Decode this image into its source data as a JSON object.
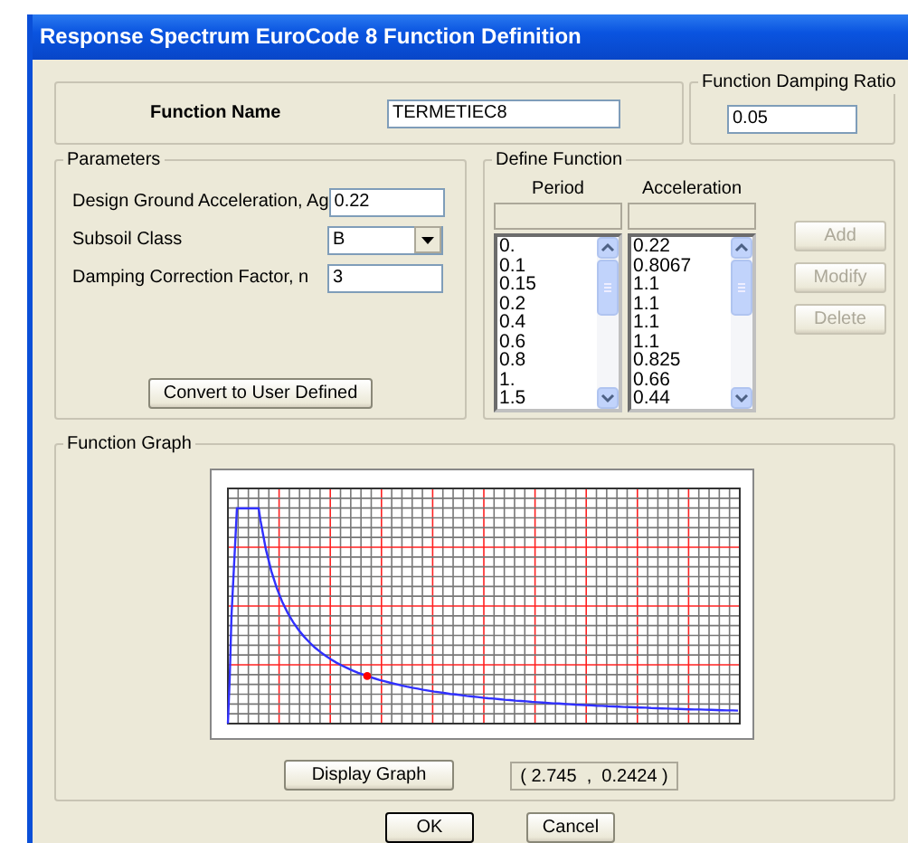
{
  "window": {
    "title": "Response Spectrum EuroCode 8 Function Definition"
  },
  "function_name": {
    "label": "Function Name",
    "value": "TERMETIEC8"
  },
  "damping_ratio": {
    "label": "Function Damping Ratio",
    "value": "0.05"
  },
  "parameters": {
    "label": "Parameters",
    "fields": [
      {
        "kind": "text",
        "label": "Design Ground Acceleration, Ag",
        "value": "0.22"
      },
      {
        "kind": "dropdown",
        "label": "Subsoil Class",
        "value": "B"
      },
      {
        "kind": "text",
        "label": "Damping Correction Factor, n",
        "value": "3"
      }
    ],
    "button": "Convert to User Defined"
  },
  "define_function": {
    "label": "Define Function",
    "columns": [
      {
        "heading": "Period",
        "items": [
          "0.",
          "0.1",
          "0.15",
          "0.2",
          "0.4",
          "0.6",
          "0.8",
          "1.",
          "1.5"
        ]
      },
      {
        "heading": "Acceleration",
        "items": [
          "0.22",
          "0.8067",
          "1.1",
          "1.1",
          "1.1",
          "1.1",
          "0.825",
          "0.66",
          "0.44"
        ]
      }
    ],
    "buttons": [
      {
        "label": "Add",
        "disabled": true
      },
      {
        "label": "Modify",
        "disabled": true
      },
      {
        "label": "Delete",
        "disabled": true
      }
    ]
  },
  "function_graph": {
    "label": "Function Graph",
    "button": "Display Graph",
    "readout": "( 2.745  ,  0.2424 )"
  },
  "buttons": [
    "OK",
    "Cancel"
  ]
}
